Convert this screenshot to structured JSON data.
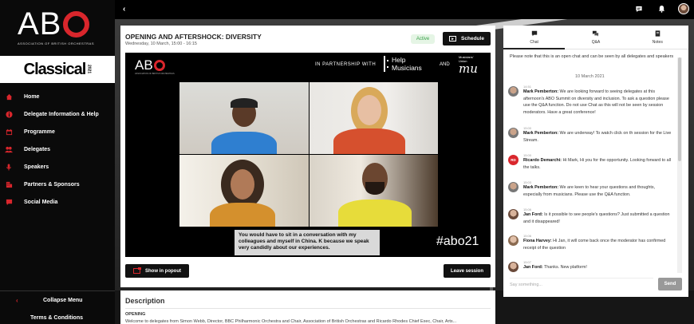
{
  "sidebar": {
    "logo": {
      "text": "ABO",
      "subtitle": "ASSOCIATION OF BRITISH ORCHESTRAS"
    },
    "sponsor": {
      "word": "Classical",
      "year": "2021"
    },
    "items": [
      {
        "label": "Home",
        "icon": "home-icon"
      },
      {
        "label": "Delegate Information & Help",
        "icon": "info-icon"
      },
      {
        "label": "Programme",
        "icon": "calendar-icon"
      },
      {
        "label": "Delegates",
        "icon": "people-icon"
      },
      {
        "label": "Speakers",
        "icon": "microphone-icon"
      },
      {
        "label": "Partners & Sponsors",
        "icon": "building-icon"
      },
      {
        "label": "Social Media",
        "icon": "speech-bubble-icon"
      }
    ],
    "collapse_label": "Collapse Menu",
    "terms_label": "Terms & Conditions"
  },
  "topbar": {
    "icons": [
      "back-chevron-icon",
      "chat-icon",
      "bell-icon",
      "avatar"
    ]
  },
  "event": {
    "title": "OPENING AND AFTERSHOCK: DIVERSITY",
    "datetime": "Wednesday, 10 March, 15:00 - 16:15",
    "status": "Active",
    "schedule_label": "Schedule"
  },
  "video": {
    "banner": {
      "abo": "ABO",
      "abo_sub": "ASSOCIATION OF BRITISH ORCHESTRAS",
      "partnership": "IN PARTNERSHIP WITH",
      "help_line1": "Help",
      "help_line2": "Musicians",
      "and": "AND",
      "mu_small1": "Musicians'",
      "mu_small2": "Union",
      "mu_big": "mu"
    },
    "caption": "You would have to sit in a conversation with my colleagues and myself in China. K because we speak very candidly about our experiences.",
    "hashtag": "#abo21"
  },
  "actions": {
    "popout_label": "Show in popout",
    "leave_label": "Leave session"
  },
  "description": {
    "title": "Description",
    "heading": "OPENING",
    "text": "Welcome to delegates from Simon Webb, Director, BBC Philharmonic Orchestra and Chair, Association of British Orchestras and Ricardo Rhodes Chief Exec, Chair, Arts..."
  },
  "chat": {
    "tabs": [
      {
        "label": "Chat",
        "icon": "chat-bubble-icon"
      },
      {
        "label": "Q&A",
        "icon": "qa-icon"
      },
      {
        "label": "Notes",
        "icon": "notes-icon"
      }
    ],
    "note": "Please note that this is an open chat and can be seen by all delegates and speakers",
    "date": "10 March 2021",
    "messages": [
      {
        "time": "14:51",
        "author": "Mark Pemberton:",
        "text": "We are looking forward to seeing delegates at this afternoon's ABO Summit on diversity and inclusion. To ask a question please use the Q&A function. Do not use Chat as this will not be seen by session moderators. Have a great conference!"
      },
      {
        "time": "15:00",
        "author": "Mark Pemberton:",
        "text": "We are underway! To watch click on th session for the Live Stream."
      },
      {
        "time": "15:00",
        "author": "Ricardo Demarchi:",
        "text": "Hi Mark, Hi you for the opportunity. Looking forward to all the talks."
      },
      {
        "time": "15:03",
        "author": "Mark Pemberton:",
        "text": "We are keen to hear your questions and thoughts, especially from musicians. Please use the Q&A function."
      },
      {
        "time": "15:06",
        "author": "Jan Ford:",
        "text": "Is it possible to see people's questions? Just submitted a question and it disappeared!"
      },
      {
        "time": "15:06",
        "author": "Fiona Harvey:",
        "text": "Hi Jan, it will come back once the moderator has confirmed receipt of the question"
      },
      {
        "time": "15:07",
        "author": "Jan Ford:",
        "text": "Thanks. New platform!"
      }
    ],
    "avatar_initials": "RD",
    "input_placeholder": "Say something...",
    "send_label": "Send"
  },
  "colors": {
    "brand_red": "#d9262c",
    "active_green": "#3aa04a",
    "sidebar_bg": "#0a0a0a"
  }
}
